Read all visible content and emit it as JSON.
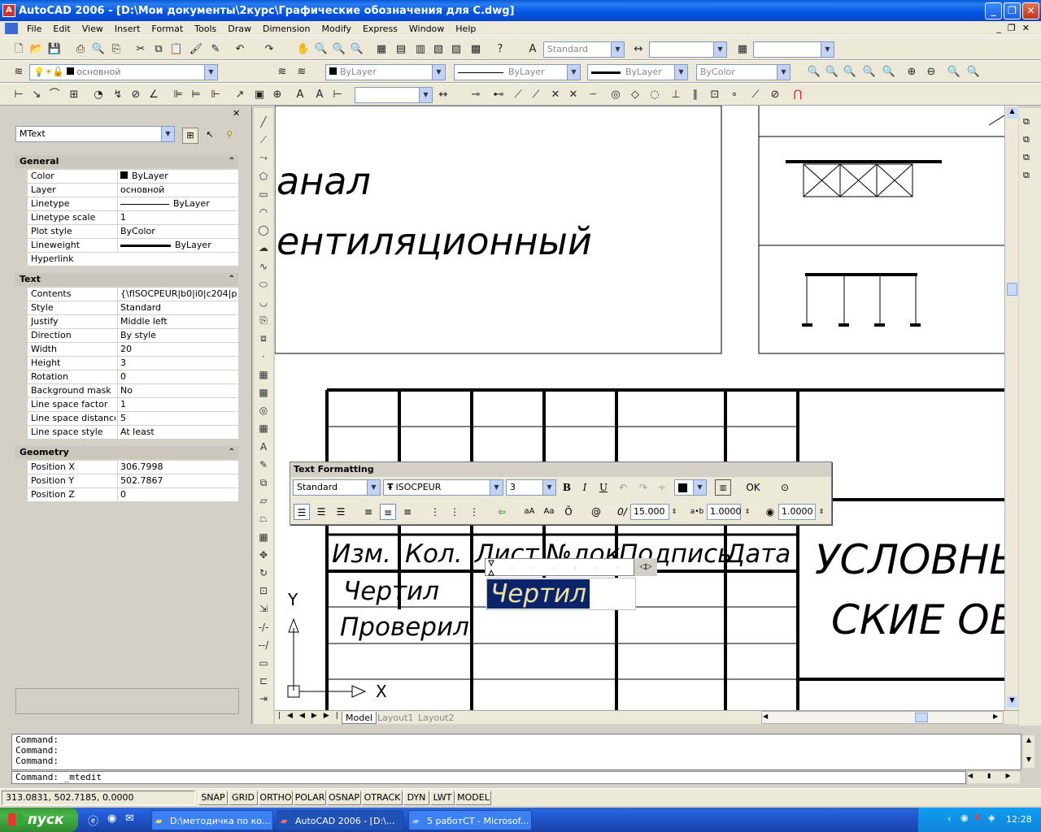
{
  "window": {
    "title": "AutoCAD 2006 - [D:\\Мои документы\\2курс\\Графические обозначения для С.dwg]"
  },
  "menu": [
    "File",
    "Edit",
    "View",
    "Insert",
    "Format",
    "Tools",
    "Draw",
    "Dimension",
    "Modify",
    "Express",
    "Window",
    "Help"
  ],
  "toolbar": {
    "text_style": "Standard",
    "layer_name": "основной",
    "color": "ByLayer",
    "linetype": "ByLayer",
    "lineweight": "ByLayer",
    "plot_style": "ByColor"
  },
  "properties": {
    "object_type": "MText",
    "groups": [
      {
        "title": "General",
        "rows": [
          {
            "k": "Color",
            "v": "ByLayer"
          },
          {
            "k": "Layer",
            "v": "основной"
          },
          {
            "k": "Linetype",
            "v": "ByLayer"
          },
          {
            "k": "Linetype scale",
            "v": "1"
          },
          {
            "k": "Plot style",
            "v": "ByColor"
          },
          {
            "k": "Lineweight",
            "v": "ByLayer"
          },
          {
            "k": "Hyperlink",
            "v": ""
          }
        ]
      },
      {
        "title": "Text",
        "rows": [
          {
            "k": "Contents",
            "v": "{\\fISOCPEUR|b0|i0|c204|p3..."
          },
          {
            "k": "Style",
            "v": "Standard"
          },
          {
            "k": "Justify",
            "v": "Middle left"
          },
          {
            "k": "Direction",
            "v": "By style"
          },
          {
            "k": "Width",
            "v": "20"
          },
          {
            "k": "Height",
            "v": "3"
          },
          {
            "k": "Rotation",
            "v": "0"
          },
          {
            "k": "Background mask",
            "v": "No"
          },
          {
            "k": "Line space factor",
            "v": "1"
          },
          {
            "k": "Line space distance",
            "v": "5"
          },
          {
            "k": "Line space style",
            "v": "At least"
          }
        ]
      },
      {
        "title": "Geometry",
        "rows": [
          {
            "k": "Position X",
            "v": "306.7998"
          },
          {
            "k": "Position Y",
            "v": "502.7867"
          },
          {
            "k": "Position Z",
            "v": "0"
          }
        ]
      }
    ]
  },
  "drawing": {
    "text_line1": "анал",
    "text_line2": "ентиляционный",
    "header_izm": "Изм.",
    "header_kol": "Кол.",
    "header_list": "Лист",
    "header_ndok": "№док",
    "header_podpis": "Подпись",
    "header_data": "Дата",
    "row_chertil": "Чертил",
    "row_proveril": "Проверил",
    "editing_text": "Чертил",
    "title_line1": "УСЛОВНЬ",
    "title_line2": "СКИЕ ОБ",
    "ucs_y": "Y",
    "ucs_x": "X"
  },
  "text_formatting": {
    "title": "Text Formatting",
    "style": "Standard",
    "font": "ISOCPEUR",
    "height": "3",
    "bold": "B",
    "italic": "I",
    "underline": "U",
    "ok": "OK",
    "oblique": "15.000",
    "tracking": "1.0000",
    "width_factor": "1.0000"
  },
  "tabs": [
    "Model",
    "Layout1",
    "Layout2"
  ],
  "command": {
    "history": [
      "Command:",
      "Command:",
      "Command:"
    ],
    "current": "Command: _mtedit"
  },
  "status": {
    "coords": "313.0831, 502.7185, 0.0000",
    "buttons": [
      "SNAP",
      "GRID",
      "ORTHO",
      "POLAR",
      "OSNAP",
      "OTRACK",
      "DYN",
      "LWT",
      "MODEL"
    ]
  },
  "taskbar": {
    "start": "пуск",
    "tasks": [
      "D:\\методичка по ко...",
      "AutoCAD 2006 - [D:\\...",
      "5 работСТ - Microsof..."
    ],
    "lang": "RU",
    "time": "12:28"
  }
}
